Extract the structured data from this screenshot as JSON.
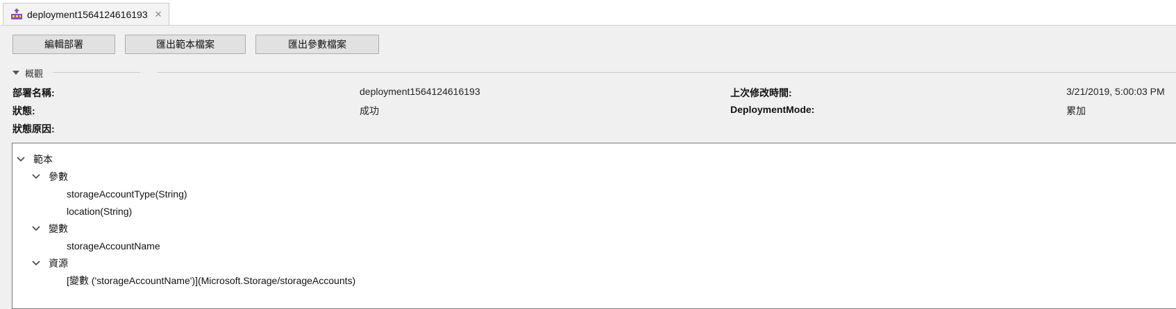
{
  "tab": {
    "title": "deployment1564124616193",
    "close_glyph": "✕",
    "icon": "deployment-icon"
  },
  "toolbar": {
    "edit_label": "編輯部署",
    "export_template_label": "匯出範本檔案",
    "export_params_label": "匯出參數檔案"
  },
  "overview": {
    "header": "概觀",
    "name_label": "部署名稱:",
    "name_value": "deployment1564124616193",
    "status_label": "狀態:",
    "status_value": "成功",
    "reason_label": "狀態原因:",
    "modified_label": "上次修改時間:",
    "modified_value": "3/21/2019, 5:00:03 PM",
    "mode_label": "DeploymentMode:",
    "mode_value": "累加"
  },
  "tree": {
    "root": "範本",
    "params": {
      "label": "參數",
      "items": [
        "storageAccountType(String)",
        "location(String)"
      ]
    },
    "vars": {
      "label": "變數",
      "items": [
        "storageAccountName"
      ]
    },
    "resources": {
      "label": "資源",
      "items": [
        "[變數 ('storageAccountName')](Microsoft.Storage/storageAccounts)"
      ]
    }
  },
  "colors": {
    "background": "#f0f0f0",
    "button": "#e1e1e1",
    "tab_icon_purple": "#8a4fb0",
    "tab_icon_gold": "#c9a227"
  }
}
